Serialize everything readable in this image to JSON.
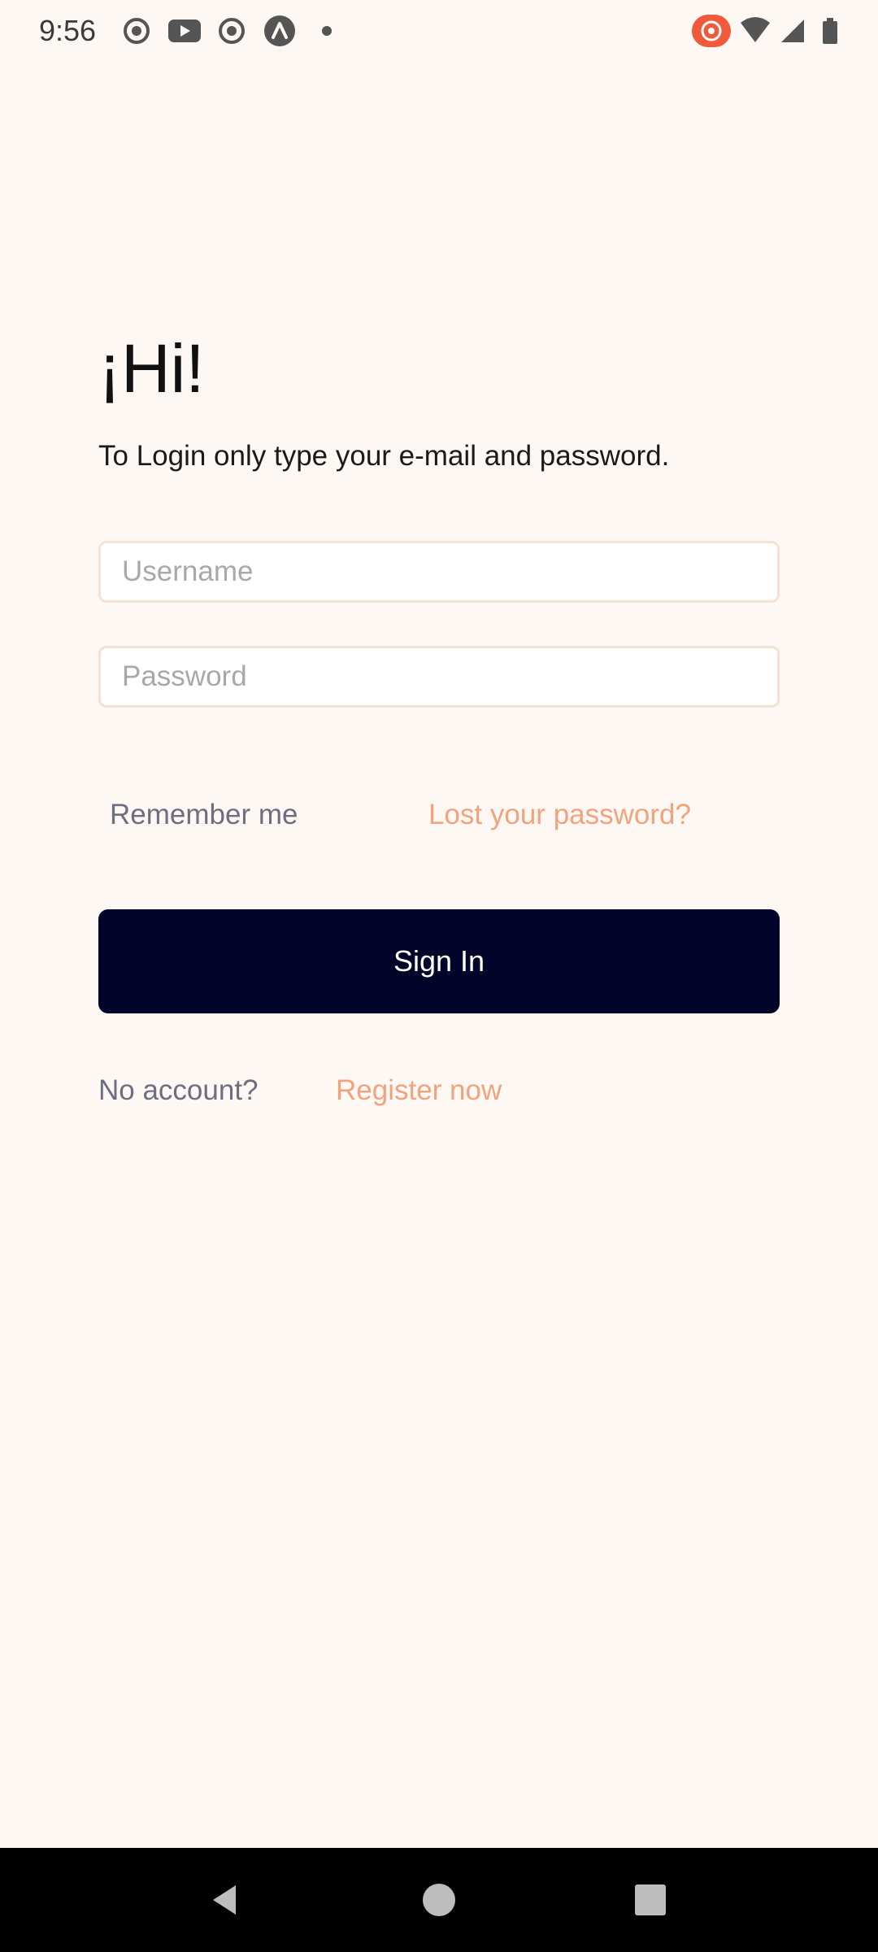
{
  "status_bar": {
    "time": "9:56",
    "left_icons": [
      "screen-record-icon",
      "youtube-icon",
      "screen-record-icon",
      "arc-app-icon",
      "notification-dot-icon"
    ],
    "right_icons": [
      "hotspot-icon",
      "wifi-icon",
      "signal-icon",
      "battery-icon"
    ]
  },
  "login": {
    "greeting": "¡Hi!",
    "subtitle": "To Login only type your e-mail and password.",
    "username_placeholder": "Username",
    "username_value": "",
    "password_placeholder": "Password",
    "password_value": "",
    "remember_label": "Remember me",
    "lost_password_label": "Lost your password?",
    "sign_in_label": "Sign In",
    "no_account_label": "No account?",
    "register_label": "Register now"
  },
  "colors": {
    "background": "#FDF8F3",
    "primary_button": "#03042A",
    "link_accent": "#F2A37E",
    "muted_text": "#6E6E80",
    "field_border": "#F6E3CF"
  },
  "nav_bar": {
    "buttons": [
      "back-icon",
      "home-icon",
      "recents-icon"
    ]
  }
}
